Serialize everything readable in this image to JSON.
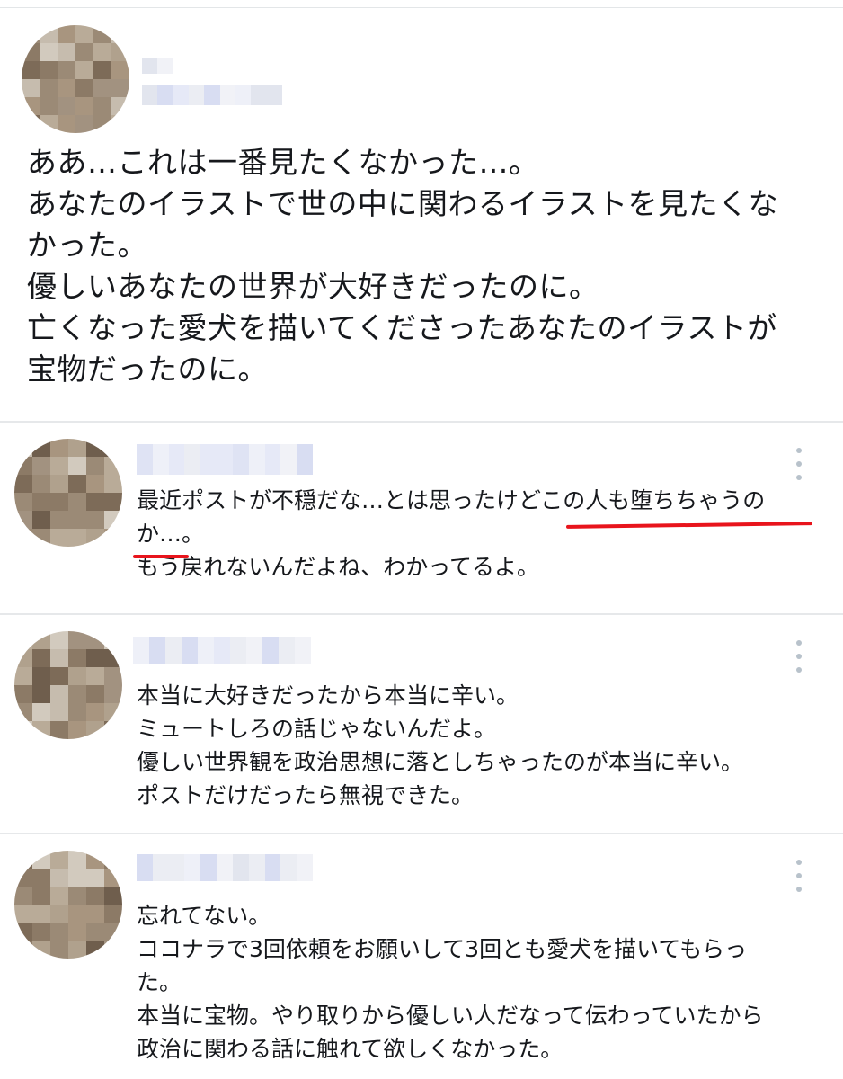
{
  "main_post": {
    "text": "ああ…これは一番見たくなかった…。\nあなたのイラストで世の中に関わるイラストを見たくな\nかった。\n優しいあなたの世界が大好きだったのに。\n亡くなった愛犬を描いてくださったあなたのイラストが\n宝物だったのに。"
  },
  "replies": [
    {
      "text": "最近ポストが不穏だな…とは思ったけどこの人も堕ちちゃうの\nか…。\nもう戻れないんだよね、わかってるよ。",
      "more_icon": "more-vertical-icon",
      "annotation_color": "#e8141c"
    },
    {
      "text": "本当に大好きだったから本当に辛い。\nミュートしろの話じゃないんだよ。\n優しい世界観を政治思想に落としちゃったのが本当に辛い。\nポストだけだったら無視できた。",
      "more_icon": "more-vertical-icon"
    },
    {
      "text": "忘れてない。\nココナラで3回依頼をお願いして3回とも愛犬を描いてもらっ\nた。\n本当に宝物。やり取りから優しい人だなって伝わっていたから\n政治に関わる話に触れて欲しくなかった。",
      "more_icon": "more-vertical-icon"
    }
  ],
  "colors": {
    "text": "#16181c",
    "divider": "#e6e8ea",
    "icon": "#b8c2cb",
    "annotation_red": "#e8141c"
  }
}
